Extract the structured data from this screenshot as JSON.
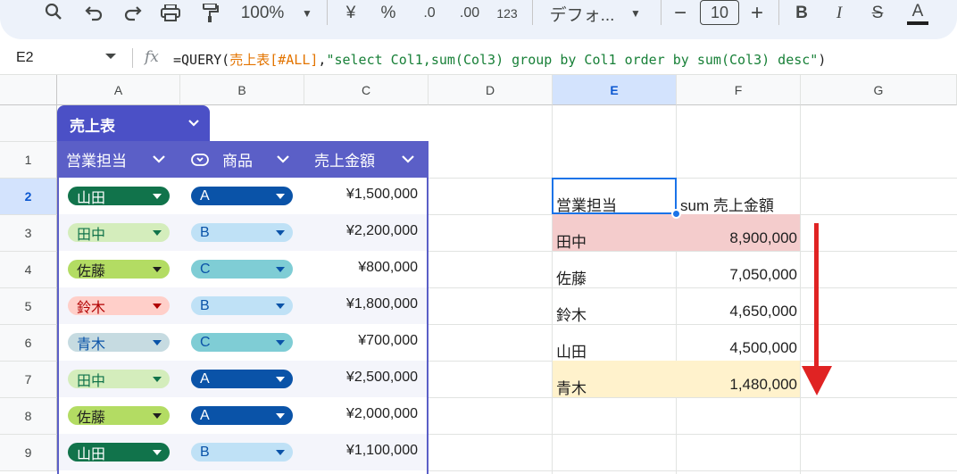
{
  "toolbar": {
    "zoom": "100%",
    "currency": "¥",
    "percent": "%",
    "dec_decrease": ".0",
    "dec_increase": ".00",
    "number_format": "123",
    "font": "デフォ...",
    "font_size": "10",
    "bold": "B",
    "italic": "I",
    "strike": "S",
    "text_color": "A"
  },
  "formula_bar": {
    "cell_ref": "E2",
    "fx": "fx",
    "formula_prefix": "=QUERY(",
    "formula_range": "売上表[#ALL]",
    "formula_comma": ",",
    "formula_string": "\"select Col1,sum(Col3) group by Col1 order by sum(Col3) desc\"",
    "formula_suffix": ")"
  },
  "columns": [
    "A",
    "B",
    "C",
    "D",
    "E",
    "F",
    "G"
  ],
  "rows": [
    "1",
    "2",
    "3",
    "4",
    "5",
    "6",
    "7",
    "8",
    "9"
  ],
  "table": {
    "name": "売上表",
    "headers": [
      "営業担当",
      "商品",
      "売上金額"
    ],
    "rows": [
      {
        "rep": "山田",
        "product": "A",
        "amount": "¥1,500,000"
      },
      {
        "rep": "田中",
        "product": "B",
        "amount": "¥2,200,000"
      },
      {
        "rep": "佐藤",
        "product": "C",
        "amount": "¥800,000"
      },
      {
        "rep": "鈴木",
        "product": "B",
        "amount": "¥1,800,000"
      },
      {
        "rep": "青木",
        "product": "C",
        "amount": "¥700,000"
      },
      {
        "rep": "田中",
        "product": "A",
        "amount": "¥2,500,000"
      },
      {
        "rep": "佐藤",
        "product": "A",
        "amount": "¥2,000,000"
      },
      {
        "rep": "山田",
        "product": "B",
        "amount": "¥1,100,000"
      }
    ]
  },
  "result": {
    "header_rep": "営業担当",
    "header_sum": "sum 売上金額",
    "rows": [
      {
        "rep": "田中",
        "sum": "8,900,000"
      },
      {
        "rep": "佐藤",
        "sum": "7,050,000"
      },
      {
        "rep": "鈴木",
        "sum": "4,650,000"
      },
      {
        "rep": "山田",
        "sum": "4,500,000"
      },
      {
        "rep": "青木",
        "sum": "1,480,000"
      }
    ]
  },
  "chip_colors": {
    "山田": {
      "bg": "#11734b",
      "fg": "#ffffff"
    },
    "田中": {
      "bg": "#d4edbc",
      "fg": "#11734b"
    },
    "佐藤": {
      "bg": "#b3dc63",
      "fg": "#1f1f1f"
    },
    "鈴木": {
      "bg": "#ffcfc9",
      "fg": "#b10202"
    },
    "青木": {
      "bg": "#c6dbe1",
      "fg": "#0a53a8"
    },
    "A": {
      "bg": "#0a53a8",
      "fg": "#ffffff"
    },
    "B": {
      "bg": "#bfe1f6",
      "fg": "#0a53a8"
    },
    "C": {
      "bg": "#7fcdd5",
      "fg": "#0a53a8"
    }
  }
}
